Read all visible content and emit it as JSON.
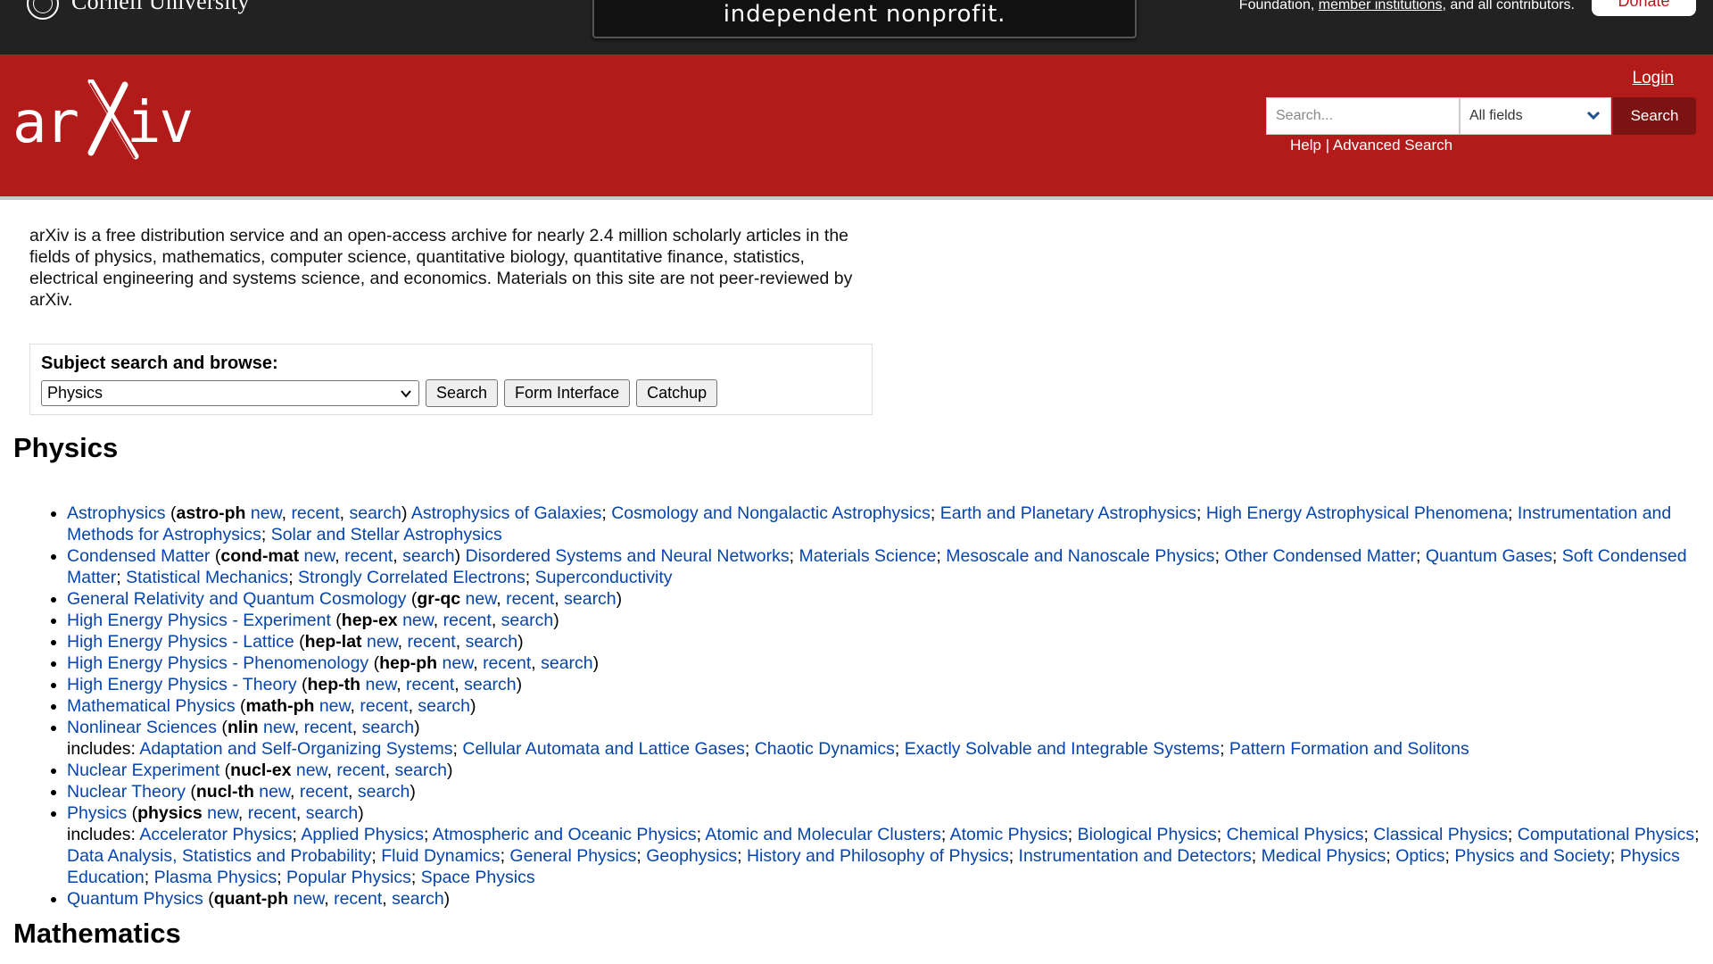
{
  "topbar": {
    "institution": "Cornell University",
    "nonprofit": "independent nonprofit.",
    "support_prefix": "Foundation, ",
    "member_link": "member institutions",
    "support_suffix": ", and all contributors.",
    "donate": "Donate"
  },
  "header": {
    "login": "Login",
    "search_placeholder": "Search...",
    "field_option": "All fields",
    "search_button": "Search",
    "help": "Help",
    "separator": " | ",
    "advanced": "Advanced Search"
  },
  "intro": "arXiv is a free distribution service and an open-access archive for nearly 2.4 million scholarly articles in the fields of physics, mathematics, computer science, quantitative biology, quantitative finance, statistics, electrical engineering and systems science, and economics. Materials on this site are not peer-reviewed by arXiv.",
  "subject": {
    "label": "Subject search and browse:",
    "selected": "Physics",
    "search": "Search",
    "form": "Form Interface",
    "catchup": "Catchup"
  },
  "sections": {
    "physics": "Physics",
    "mathematics": "Mathematics"
  },
  "links": {
    "new": "new",
    "recent": "recent",
    "search": "search"
  },
  "physics": [
    {
      "name": "Astrophysics",
      "code": "astro-ph",
      "sub": [
        "Astrophysics of Galaxies",
        "Cosmology and Nongalactic Astrophysics",
        "Earth and Planetary Astrophysics",
        "High Energy Astrophysical Phenomena",
        "Instrumentation and Methods for Astrophysics",
        "Solar and Stellar Astrophysics"
      ]
    },
    {
      "name": "Condensed Matter",
      "code": "cond-mat",
      "sub": [
        "Disordered Systems and Neural Networks",
        "Materials Science",
        "Mesoscale and Nanoscale Physics",
        "Other Condensed Matter",
        "Quantum Gases",
        "Soft Condensed Matter",
        "Statistical Mechanics",
        "Strongly Correlated Electrons",
        "Superconductivity"
      ]
    },
    {
      "name": "General Relativity and Quantum Cosmology",
      "code": "gr-qc"
    },
    {
      "name": "High Energy Physics - Experiment",
      "code": "hep-ex"
    },
    {
      "name": "High Energy Physics - Lattice",
      "code": "hep-lat"
    },
    {
      "name": "High Energy Physics - Phenomenology",
      "code": "hep-ph"
    },
    {
      "name": "High Energy Physics - Theory",
      "code": "hep-th"
    },
    {
      "name": "Mathematical Physics",
      "code": "math-ph"
    },
    {
      "name": "Nonlinear Sciences",
      "code": "nlin",
      "includes": [
        "Adaptation and Self-Organizing Systems",
        "Cellular Automata and Lattice Gases",
        "Chaotic Dynamics",
        "Exactly Solvable and Integrable Systems",
        "Pattern Formation and Solitons"
      ]
    },
    {
      "name": "Nuclear Experiment",
      "code": "nucl-ex"
    },
    {
      "name": "Nuclear Theory",
      "code": "nucl-th"
    },
    {
      "name": "Physics",
      "code": "physics",
      "includes": [
        "Accelerator Physics",
        "Applied Physics",
        "Atmospheric and Oceanic Physics",
        "Atomic and Molecular Clusters",
        "Atomic Physics",
        "Biological Physics",
        "Chemical Physics",
        "Classical Physics",
        "Computational Physics",
        "Data Analysis, Statistics and Probability",
        "Fluid Dynamics",
        "General Physics",
        "Geophysics",
        "History and Philosophy of Physics",
        "Instrumentation and Detectors",
        "Medical Physics",
        "Optics",
        "Physics and Society",
        "Physics Education",
        "Plasma Physics",
        "Popular Physics",
        "Space Physics"
      ]
    },
    {
      "name": "Quantum Physics",
      "code": "quant-ph"
    }
  ],
  "includes_label": "includes: "
}
